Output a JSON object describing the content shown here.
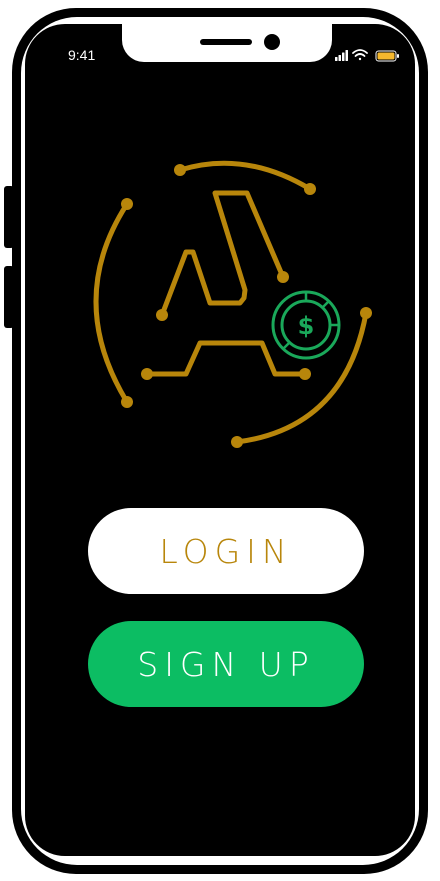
{
  "status_bar": {
    "time": "9:41"
  },
  "logo": {
    "name": "logo-mark",
    "icons": [
      "circuit-a-icon",
      "dollar-coin-icon"
    ],
    "colors": {
      "gold": "#b8860b",
      "green": "#1aa85a"
    },
    "coin_symbol": "$"
  },
  "buttons": {
    "login_label": "LOGIN",
    "signup_label": "SIGN UP"
  },
  "colors": {
    "screen_bg": "#000000",
    "login_bg": "#ffffff",
    "login_text": "#b8860b",
    "signup_bg": "#0cbd63",
    "signup_text": "#ffffff"
  }
}
